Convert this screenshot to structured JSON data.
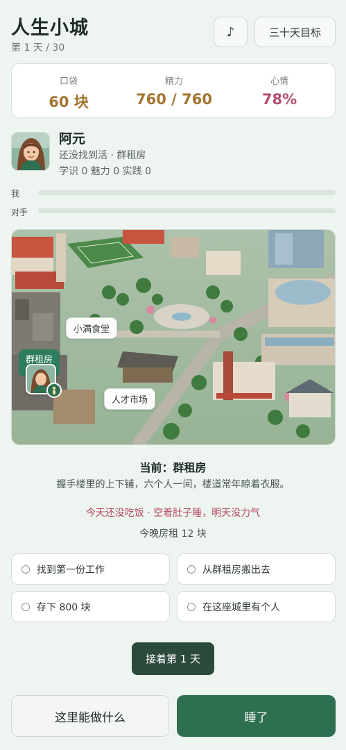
{
  "header": {
    "title": "人生小城",
    "day": "第 1 天 / 30",
    "music_label": "♪",
    "goal_button": "三十天目标"
  },
  "stats": {
    "money_label": "口袋",
    "money_value": "60 块",
    "energy_label": "精力",
    "energy_value": "760 / 760",
    "mood_label": "心情",
    "mood_value": "78%",
    "colors": {
      "money": "#a37530",
      "energy": "#a37530",
      "mood": "#b2506f"
    }
  },
  "profile": {
    "name": "阿元",
    "status": "还没找到活 · 群租房",
    "attributes": "学识 0 魅力 0 实践 0",
    "avatar": "avatar-girl"
  },
  "progress": {
    "me_label": "我",
    "me_value": 0,
    "rival_label": "对手",
    "rival_value": 0
  },
  "map": {
    "places": [
      "小满食堂",
      "人才市场"
    ],
    "current_place_tag": "群租房",
    "badge_icon": "person-icon"
  },
  "location": {
    "title": "当前：群租房",
    "description": "握手楼里的上下铺，六个人一间，楼道常年晾着衣服。",
    "warning": "今天还没吃饭 · 空着肚子睡，明天没力气",
    "rent": "今晚房租 12 块"
  },
  "goals": [
    {
      "label": "找到第一份工作"
    },
    {
      "label": "从群租房搬出去"
    },
    {
      "label": "存下 800 块"
    },
    {
      "label": "在这座城里有个人"
    }
  ],
  "actions": {
    "continue": "接着第 1 天",
    "explore": "这里能做什么",
    "sleep": "睡了"
  }
}
